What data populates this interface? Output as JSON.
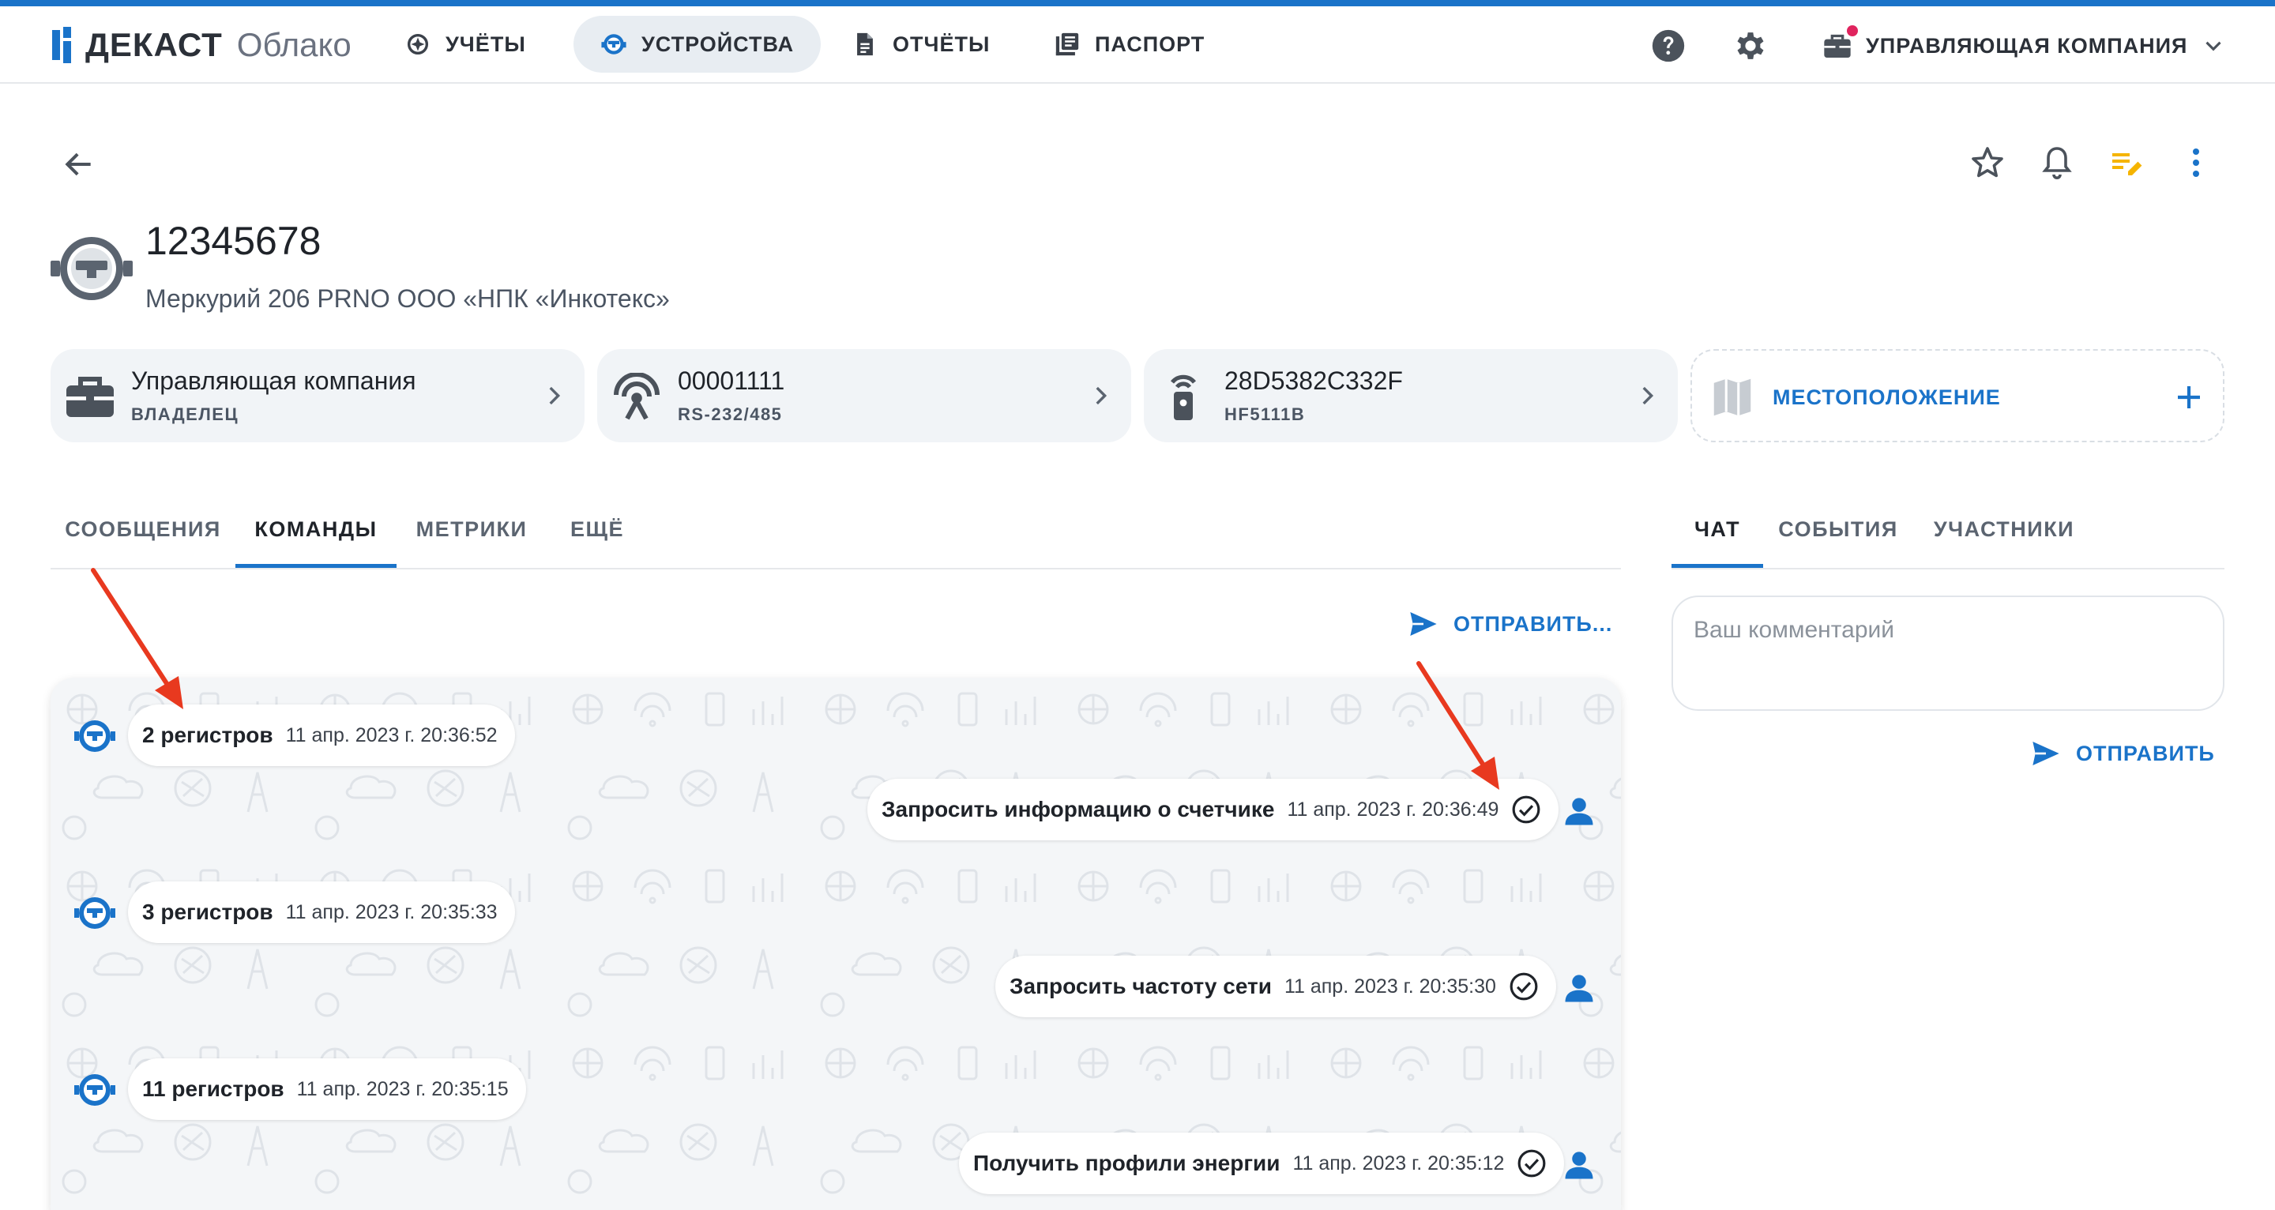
{
  "brand": {
    "name": "ДЕКАСТ",
    "product": "Облако"
  },
  "nav": {
    "items": [
      {
        "label": "УЧЁТЫ",
        "icon": "accounting-icon"
      },
      {
        "label": "УСТРОЙСТВА",
        "icon": "meter-icon",
        "active": true
      },
      {
        "label": "ОТЧЁТЫ",
        "icon": "report-icon"
      },
      {
        "label": "ПАСПОРТ",
        "icon": "passport-icon"
      }
    ],
    "help_icon": "help-icon",
    "settings_icon": "gear-icon",
    "company": "УПРАВЛЯЮЩАЯ КОМПАНИЯ"
  },
  "device": {
    "title": "12345678",
    "subtitle": "Меркурий 206 PRNO ООО «НПК «Инкотекс»"
  },
  "cards": [
    {
      "title": "Управляющая компания",
      "caption": "ВЛАДЕЛЕЦ",
      "icon": "briefcase-icon"
    },
    {
      "title": "00001111",
      "caption": "RS-232/485",
      "icon": "antenna-icon"
    },
    {
      "title": "28D5382C332F",
      "caption": "HF5111B",
      "icon": "modem-icon"
    }
  ],
  "location": {
    "label": "МЕСТОПОЛОЖЕНИЕ",
    "icon": "map-icon"
  },
  "tabs": {
    "left": [
      "СООБЩЕНИЯ",
      "КОМАНДЫ",
      "МЕТРИКИ",
      "ЕЩЁ"
    ],
    "left_active": "КОМАНДЫ",
    "right": [
      "ЧАТ",
      "СОБЫТИЯ",
      "УЧАСТНИКИ"
    ],
    "right_active": "ЧАТ"
  },
  "send_command_label": "ОТПРАВИТЬ...",
  "messages": [
    {
      "side": "in",
      "text": "2 регистров",
      "time": "11 апр. 2023 г. 20:36:52"
    },
    {
      "side": "out",
      "text": "Запросить информацию о счетчике",
      "time": "11 апр. 2023 г. 20:36:49",
      "status": "delivered"
    },
    {
      "side": "in",
      "text": "3 регистров",
      "time": "11 апр. 2023 г. 20:35:33"
    },
    {
      "side": "out",
      "text": "Запросить частоту сети",
      "time": "11 апр. 2023 г. 20:35:30",
      "status": "delivered"
    },
    {
      "side": "in",
      "text": "11 регистров",
      "time": "11 апр. 2023 г. 20:35:15"
    },
    {
      "side": "out",
      "text": "Получить профили энергии",
      "time": "11 апр. 2023 г. 20:35:12",
      "status": "delivered"
    }
  ],
  "comment": {
    "placeholder": "Ваш комментарий",
    "send_label": "ОТПРАВИТЬ"
  },
  "colors": {
    "accent": "#1a73c9",
    "annotation_arrow": "#e8391f",
    "notification_dot": "#e0245e",
    "edit_icon": "#f5b400"
  }
}
